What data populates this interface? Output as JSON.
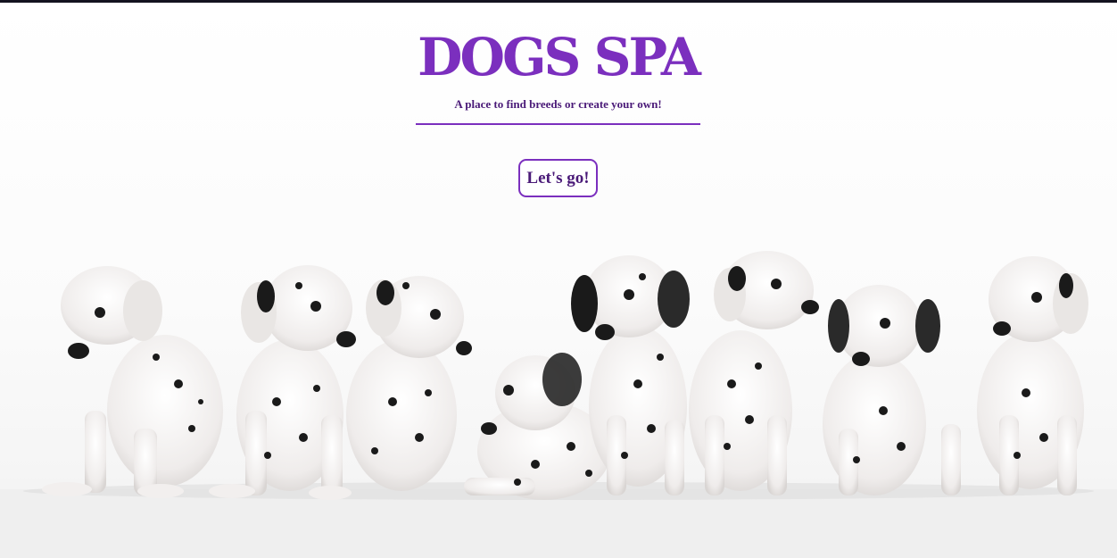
{
  "hero": {
    "title": "DOGS SPA",
    "subtitle": "A place to find breeds or create your own!",
    "cta_label": "Let's go!"
  },
  "background_image": {
    "subject": "dalmatian-puppies-photo",
    "count": 8
  },
  "colors": {
    "accent": "#7b2fbe",
    "accent_dark": "#4a1a78",
    "background": "#ffffff",
    "spots": "#1a1a1a",
    "fur": "#f4f2f0"
  }
}
